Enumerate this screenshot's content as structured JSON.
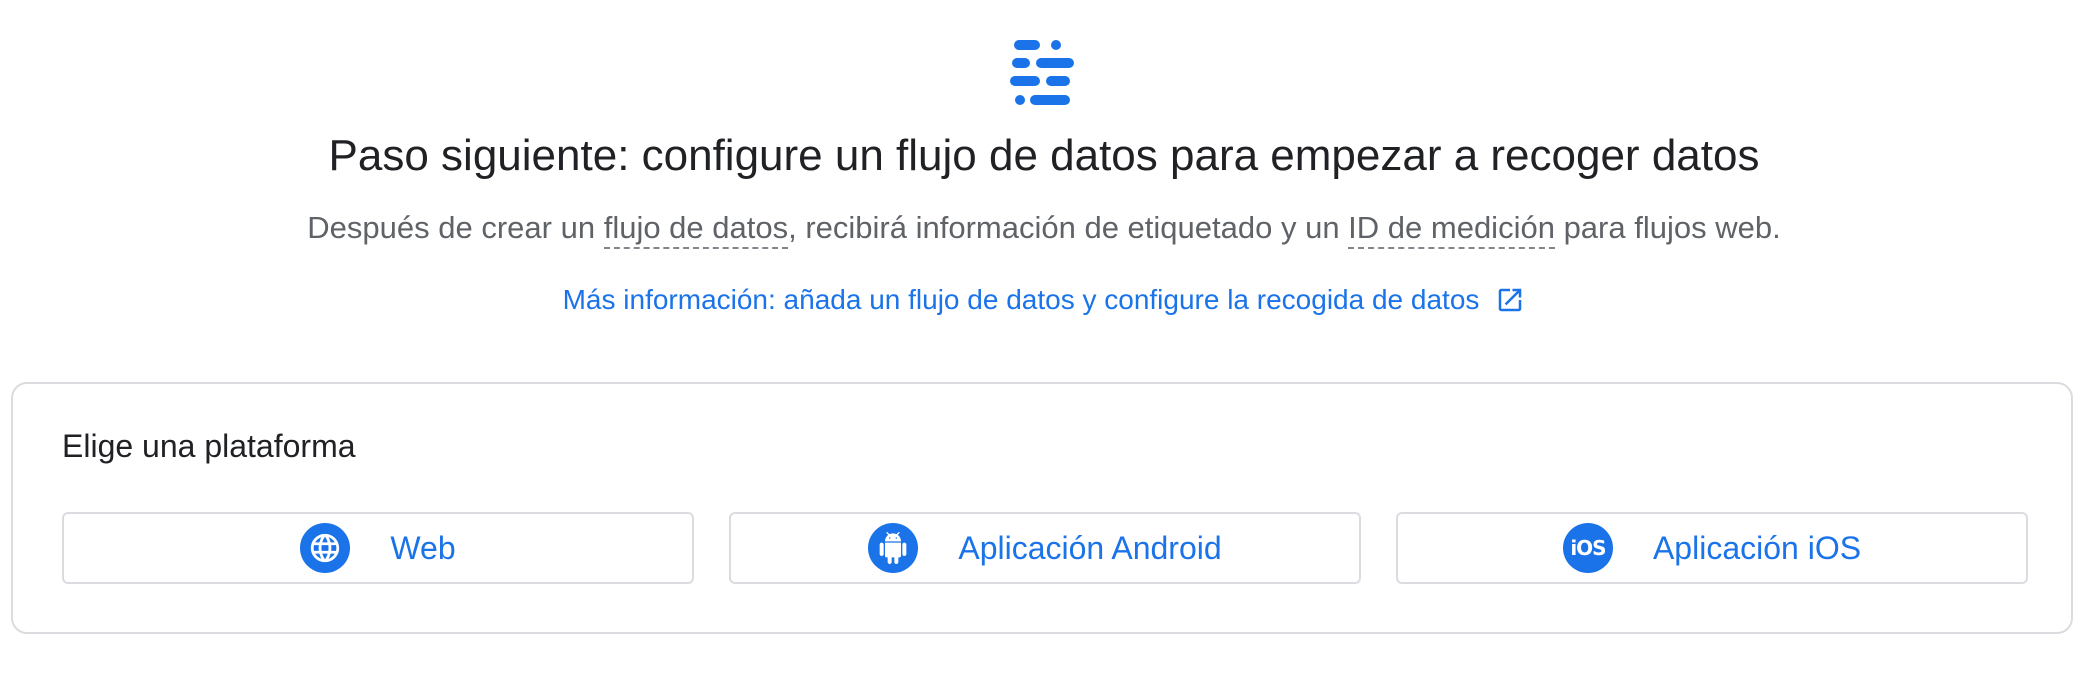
{
  "header": {
    "icon": "data-stream-icon",
    "title": "Paso siguiente: configure un flujo de datos para empezar a recoger datos",
    "sub_before": "Después de crear un ",
    "sub_term1": "flujo de datos",
    "sub_middle": ", recibirá información de etiquetado y un ",
    "sub_term2": "ID de medición",
    "sub_after": " para flujos web.",
    "learn_more": "Más información: añada un flujo de datos y configure la recogida de datos"
  },
  "platform_panel": {
    "title": "Elige una plataforma",
    "options": [
      {
        "label": "Web",
        "icon": "globe-icon"
      },
      {
        "label": "Aplicación Android",
        "icon": "android-icon"
      },
      {
        "label": "Aplicación iOS",
        "icon": "ios-icon",
        "badge_text": "iOS"
      }
    ]
  },
  "colors": {
    "accent": "#1a73e8",
    "text_primary": "#202124",
    "text_secondary": "#5f6368",
    "border": "#dadce0"
  }
}
